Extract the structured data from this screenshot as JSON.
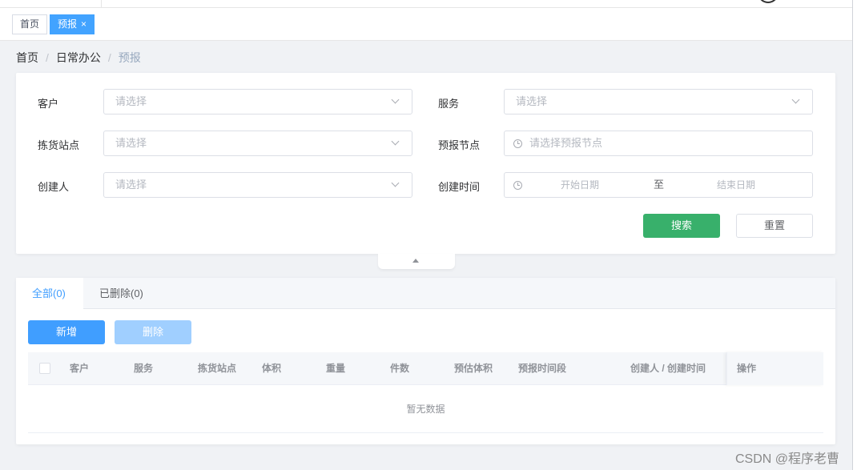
{
  "tags": {
    "home": "首页",
    "forecast": "预报",
    "close_glyph": "×"
  },
  "breadcrumb": {
    "home": "首页",
    "sep": "/",
    "office": "日常办公",
    "current": "预报"
  },
  "form": {
    "customer": {
      "label": "客户",
      "placeholder": "请选择"
    },
    "service": {
      "label": "服务",
      "placeholder": "请选择"
    },
    "station": {
      "label": "拣货站点",
      "placeholder": "请选择"
    },
    "node": {
      "label": "预报节点",
      "placeholder": "请选择预报节点"
    },
    "creator": {
      "label": "创建人",
      "placeholder": "请选择"
    },
    "created_time": {
      "label": "创建时间",
      "start": "开始日期",
      "sep": "至",
      "end": "结束日期"
    },
    "search_label": "搜索",
    "reset_label": "重置"
  },
  "tabs": [
    {
      "label": "全部(0)"
    },
    {
      "label": "已删除(0)"
    }
  ],
  "toolbar": {
    "add_label": "新增",
    "delete_label": "删除"
  },
  "table": {
    "columns": [
      "客户",
      "服务",
      "拣货站点",
      "体积",
      "重量",
      "件数",
      "预估体积",
      "预报时间段",
      "创建人 / 创建时间",
      "操作"
    ],
    "empty_text": "暂无数据"
  },
  "watermark": "CSDN @程序老曹",
  "colors": {
    "primary": "#409eff",
    "search": "#38b06b",
    "tag_active": "#42a3ff",
    "disabled": "#a0cfff"
  }
}
